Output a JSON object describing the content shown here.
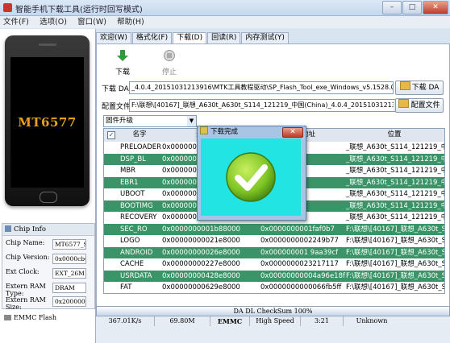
{
  "window": {
    "title": "智能手机下载工具(运行时回写模式)",
    "buttons": [
      "–",
      "□",
      "✕"
    ]
  },
  "menu": [
    "文件(F)",
    "选项(O)",
    "窗口(W)",
    "帮助(H)"
  ],
  "phone": {
    "screen_text": "MT6577"
  },
  "chip_info": {
    "title": "Chip Info",
    "rows": [
      {
        "label": "Chip Name:",
        "value": "MT6577_S00"
      },
      {
        "label": "Chip Version:",
        "value": "0x0000cb00"
      },
      {
        "label": "Ext Clock:",
        "value": "EXT_26M"
      },
      {
        "label": "Extern RAM Type:",
        "value": "DRAM"
      },
      {
        "label": "Extern RAM Size:",
        "value": "0x20000000"
      }
    ],
    "emmc_label": "EMMC Flash"
  },
  "tabs": [
    "欢迎(W)",
    "格式化(F)",
    "下载(D)",
    "回读(R)",
    "内存测试(Y)"
  ],
  "toolbar": {
    "download": "下载",
    "stop": "停止"
  },
  "download_agent": {
    "label": "下载 DA",
    "path": "_4.0.4_20151031213916\\MTK工具教程驱动\\SP_Flash_Tool_exe_Windows_v5.1528.00.000\\MTK_AllInOne_DA.bin",
    "button": "下载 DA"
  },
  "scatter": {
    "label": "配置文件",
    "path": "F:\\联想\\[40167]_联想_A630t_A630t_S114_121219_中国(China)_4.0.4_20151031213916\\刷机包\\MT6577_Andr",
    "button": "配置文件"
  },
  "mode_select": "固件升级",
  "table": {
    "headers": [
      "名字",
      "开始地址",
      "结束地址",
      "位置"
    ],
    "rows": [
      {
        "name": "PRELOADER",
        "start": "0x000000000000",
        "end": "",
        "loc": "_联想_A630t_S114_121219_中国(Chin"
      },
      {
        "name": "DSP_BL",
        "start": "0x000000000000",
        "end": "",
        "loc": "_联想_A630t_S114_121219_中国(Chin"
      },
      {
        "name": "MBR",
        "start": "0x000000000060",
        "end": "",
        "loc": "_联想_A630t_S114_121219_中国(Chin"
      },
      {
        "name": "EBR1",
        "start": "0x000000000060",
        "end": "",
        "loc": "_联想_A630t_S114_121219_中国(Chin"
      },
      {
        "name": "UBOOT",
        "start": "0x000000000f28",
        "end": "",
        "loc": "_联想_A630t_S114_121219_中国(Chin"
      },
      {
        "name": "BOOTIMG",
        "start": "0x000000000f88",
        "end": "",
        "loc": "_联想_A630t_S114_121219_中国(Chin"
      },
      {
        "name": "RECOVERY",
        "start": "0x000000001588",
        "end": "",
        "loc": "_联想_A630t_S114_121219_中国(Chin"
      },
      {
        "name": "SEC_RO",
        "start": "0x0000000001b88000",
        "end": "0x0000000001faf0b7",
        "loc": "F:\\联想\\[40167]_联想_A630t_S114_121219_中国(Chin"
      },
      {
        "name": "LOGO",
        "start": "0x00000000021e8000",
        "end": "0x0000000002249b77",
        "loc": "F:\\联想\\[40167]_联想_A630t_S114_121219_中国(Chin"
      },
      {
        "name": "ANDROID",
        "start": "0x00000000026e8000",
        "end": "0x000000001 9aa39cf",
        "loc": "F:\\联想\\[40167]_联想_A630t_S114_121219_中国(Chin"
      },
      {
        "name": "CACHE",
        "start": "0x00000000227e8000",
        "end": "0x0000000023217117",
        "loc": "F:\\联想\\[40167]_联想_A630t_S114_121219_中国(Chin"
      },
      {
        "name": "USRDATA",
        "start": "0x00000000428e8000",
        "end": "0x00000000004a96e18f",
        "loc": "F:\\联想\\[40167]_联想_A630t_S114_121219_中国(Chin"
      },
      {
        "name": "FAT",
        "start": "0x00000000629e8000",
        "end": "0x0000000000066fb5ff",
        "loc": "F:\\联想\\[40167]_联想_A630t_S114_121219_中国(Chin"
      }
    ]
  },
  "status": {
    "progress_text": "DA DL CheckSum 100%",
    "progress": 1.0,
    "speed": "367.01K/s",
    "size": "69.80M",
    "storage": "EMMC",
    "usb": "High Speed",
    "time": "3:21",
    "extra": "Unknown"
  },
  "dialog": {
    "title": "下载完成",
    "close": "✕"
  },
  "colors": {
    "green_row": "#3a9467",
    "dialog_bg": "#22e5e3",
    "check_green": "#8ad02e"
  }
}
